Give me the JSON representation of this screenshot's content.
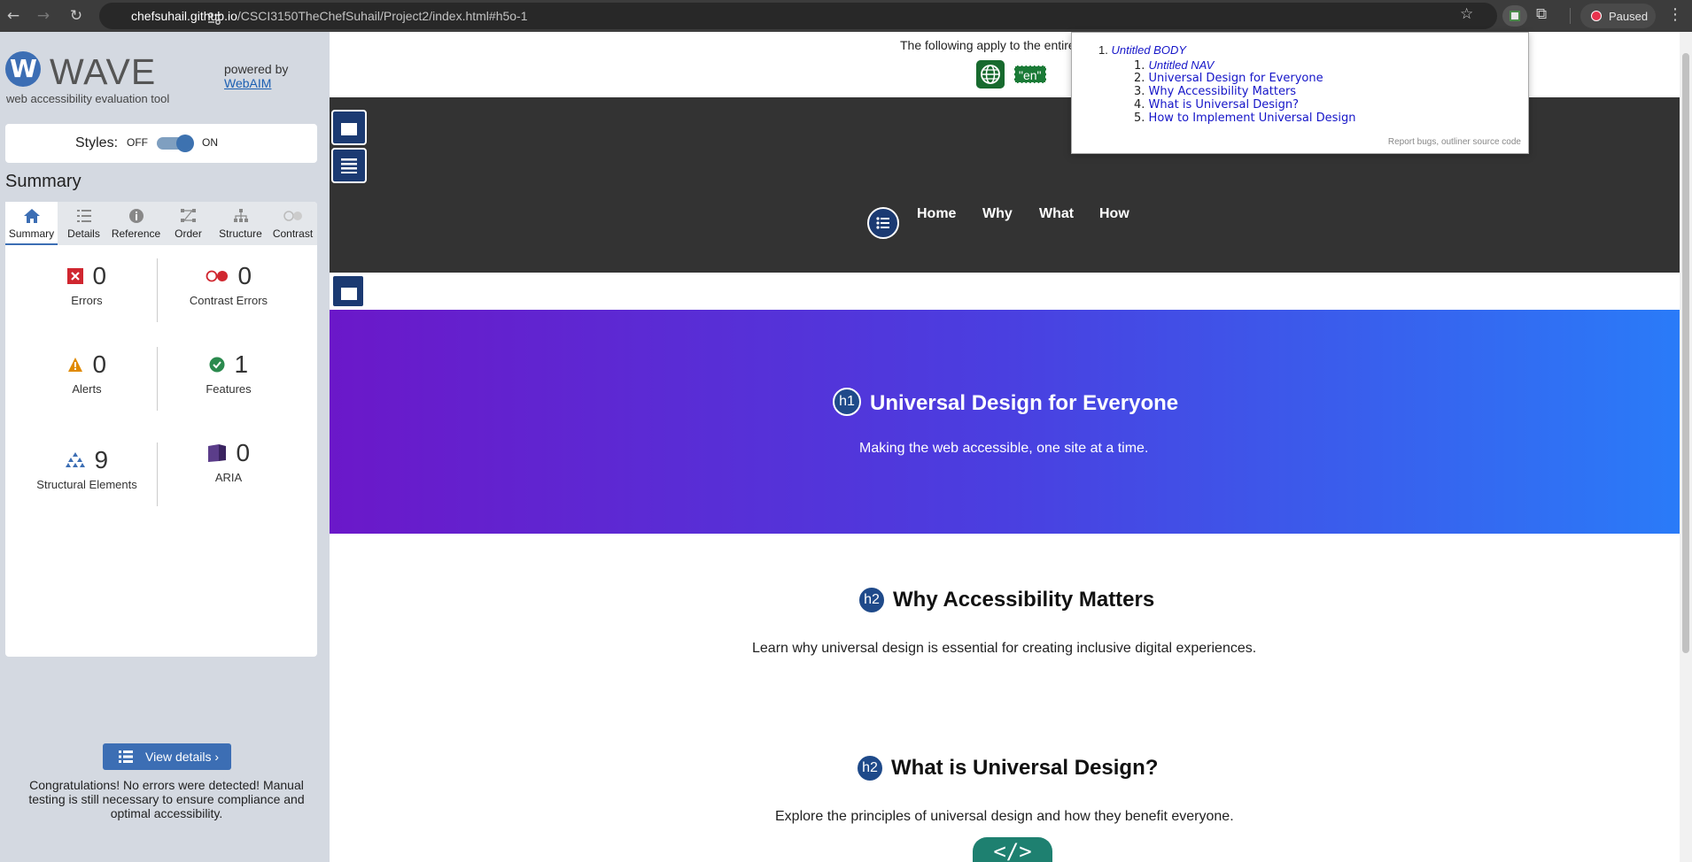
{
  "browser": {
    "url_host": "chefsuhail.github.io",
    "url_path": "/CSCI3150TheChefSuhail/Project2/index.html#h5o-1",
    "profile_status": "Paused",
    "icons": [
      "back-arrow-icon",
      "forward-arrow-icon",
      "reload-icon",
      "site-info-icon",
      "star-icon",
      "wave-extension-icon",
      "puzzle-icon",
      "kebab-menu-icon"
    ]
  },
  "wave": {
    "title": "WAVE",
    "tagline": "web accessibility evaluation tool",
    "powered_by": "powered by",
    "webaim_link": "WebAIM",
    "styles_label": "Styles:",
    "styles_off": "OFF",
    "styles_on": "ON",
    "styles_enabled": true,
    "summary_heading": "Summary",
    "tabs": [
      {
        "label": "Summary",
        "icon": "home-icon",
        "active": true
      },
      {
        "label": "Details",
        "icon": "list-icon",
        "active": false
      },
      {
        "label": "Reference",
        "icon": "info-icon",
        "active": false
      },
      {
        "label": "Order",
        "icon": "order-icon",
        "active": false
      },
      {
        "label": "Structure",
        "icon": "structure-icon",
        "active": false
      },
      {
        "label": "Contrast",
        "icon": "contrast-icon",
        "active": false
      }
    ],
    "stats": [
      {
        "label": "Errors",
        "value": "0",
        "icon": "error-icon",
        "color": "#d0262f"
      },
      {
        "label": "Contrast Errors",
        "value": "0",
        "icon": "contrast-error-icon",
        "color": "#d0262f"
      },
      {
        "label": "Alerts",
        "value": "0",
        "icon": "alert-icon",
        "color": "#e08a00"
      },
      {
        "label": "Features",
        "value": "1",
        "icon": "feature-icon",
        "color": "#2b8a4e"
      },
      {
        "label": "Structural Elements",
        "value": "9",
        "icon": "structure-icon",
        "color": "#3c6eb4"
      },
      {
        "label": "ARIA",
        "value": "0",
        "icon": "aria-icon",
        "color": "#5b3d8a"
      }
    ],
    "view_details_label": "View details ›",
    "congrats": "Congratulations! No errors were detected! Manual testing is still necessary to ensure compliance and optimal accessibility."
  },
  "page": {
    "lang_notice": "The following apply to the entire",
    "lang_tag": "\"en\"",
    "nav": [
      "Home",
      "Why",
      "What",
      "How"
    ],
    "hero": {
      "heading_level": "h1",
      "title": "Universal Design for Everyone",
      "subtitle": "Making the web accessible, one site at a time."
    },
    "sections": [
      {
        "heading_level": "h2",
        "title": "Why Accessibility Matters",
        "text": "Learn why universal design is essential for creating inclusive digital experiences."
      },
      {
        "heading_level": "h2",
        "title": "What is Universal Design?",
        "text": "Explore the principles of universal design and how they benefit everyone."
      }
    ],
    "code_tag": "</>"
  },
  "outliner": {
    "root_number": "1.",
    "root": "Untitled BODY",
    "items": [
      {
        "num": "1.",
        "label": "Untitled NAV",
        "italic": true
      },
      {
        "num": "2.",
        "label": "Universal Design for Everyone",
        "italic": false
      },
      {
        "num": "3.",
        "label": "Why Accessibility Matters",
        "italic": false
      },
      {
        "num": "4.",
        "label": "What is Universal Design?",
        "italic": false
      },
      {
        "num": "5.",
        "label": "How to Implement Universal Design",
        "italic": false
      }
    ],
    "footer_report": "Report bugs",
    "footer_sep": ",",
    "footer_source": "outliner source code"
  }
}
